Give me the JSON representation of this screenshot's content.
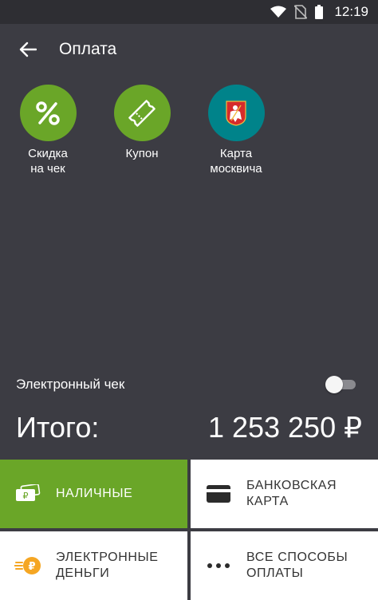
{
  "status_bar": {
    "time": "12:19"
  },
  "app_bar": {
    "title": "Оплата"
  },
  "discounts": [
    {
      "label": "Скидка\nна чек",
      "icon": "percent-icon",
      "color": "#6aa628"
    },
    {
      "label": "Купон",
      "icon": "coupon-ticket-icon",
      "color": "#6aa628"
    },
    {
      "label": "Карта\nмосквича",
      "icon": "moscow-coat-of-arms-icon",
      "color": "#00838a"
    }
  ],
  "e_check": {
    "label": "Электронный чек",
    "enabled": false
  },
  "total": {
    "label": "Итого:",
    "amount": "1 253 250 ₽"
  },
  "payment_methods": [
    {
      "label": "НАЛИЧНЫЕ",
      "icon": "cash-banknote-icon",
      "active": true
    },
    {
      "label": "БАНКОВСКАЯ\nКАРТА",
      "icon": "bank-card-icon",
      "active": false
    },
    {
      "label": "ЭЛЕКТРОННЫЕ\nДЕНЬГИ",
      "icon": "electronic-money-icon",
      "active": false
    },
    {
      "label": "ВСЕ СПОСОБЫ\nОПЛАТЫ",
      "icon": "more-dots-icon",
      "active": false
    }
  ],
  "colors": {
    "accent_green": "#6aa628",
    "teal": "#00838a",
    "background": "#3c3c43"
  }
}
